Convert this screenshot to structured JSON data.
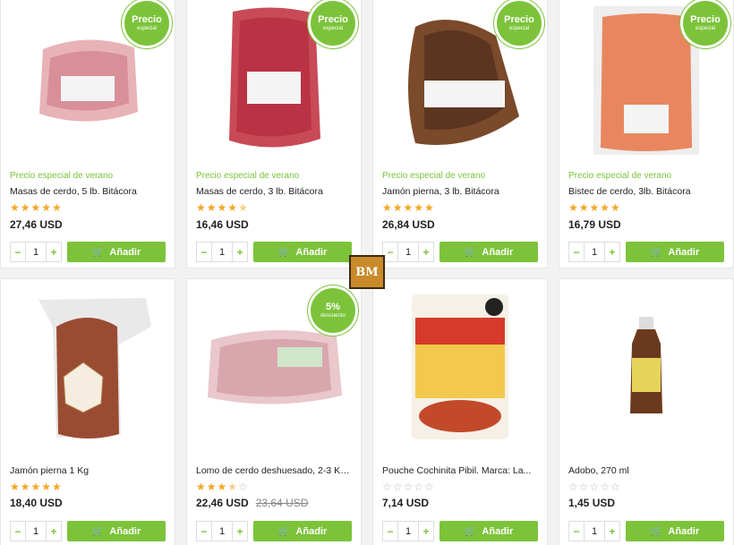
{
  "colors": {
    "accent": "#7cc33a",
    "star": "#f5a623"
  },
  "add_label": "Añadir",
  "products": [
    {
      "badge": "Precio",
      "badge_sub": "especial",
      "promo": "Precio especial de verano",
      "title": "Masas de cerdo, 5 lb. Bitácora",
      "stars": 5,
      "price": "27,46 USD",
      "old_price": "",
      "qty": "1"
    },
    {
      "badge": "Precio",
      "badge_sub": "especial",
      "promo": "Precio especial de verano",
      "title": "Masas de cerdo, 3 lb. Bitácora",
      "stars": 4.5,
      "price": "16,46 USD",
      "old_price": "",
      "qty": "1"
    },
    {
      "badge": "Precio",
      "badge_sub": "especial",
      "promo": "Precio especial de verano",
      "title": "Jamón pierna, 3 lb. Bitácora",
      "stars": 5,
      "price": "26,84 USD",
      "old_price": "",
      "qty": "1"
    },
    {
      "badge": "Precio",
      "badge_sub": "especial",
      "promo": "Precio especial de verano",
      "title": "Bistec de cerdo, 3lb. Bitácora",
      "stars": 5,
      "price": "16,79 USD",
      "old_price": "",
      "qty": "1"
    },
    {
      "badge": "",
      "badge_sub": "",
      "promo": "",
      "title": "Jamón pierna 1 Kg",
      "stars": 5,
      "price": "18,40 USD",
      "old_price": "",
      "qty": "1"
    },
    {
      "badge": "5%",
      "badge_sub": "descuento",
      "promo": "",
      "title": "Lomo de cerdo deshuesado, 2-3 Kg,...",
      "stars": 3.5,
      "price": "22,46 USD",
      "old_price": "23,64 USD",
      "qty": "1"
    },
    {
      "badge": "",
      "badge_sub": "",
      "promo": "",
      "title": "Pouche Cochinita Pibil. Marca: La...",
      "stars": 0,
      "price": "7,14 USD",
      "old_price": "",
      "qty": "1"
    },
    {
      "badge": "",
      "badge_sub": "",
      "promo": "",
      "title": "Adobo, 270 ml",
      "stars": 0,
      "price": "1,45 USD",
      "old_price": "",
      "qty": "1"
    }
  ],
  "logo_text": "BM"
}
